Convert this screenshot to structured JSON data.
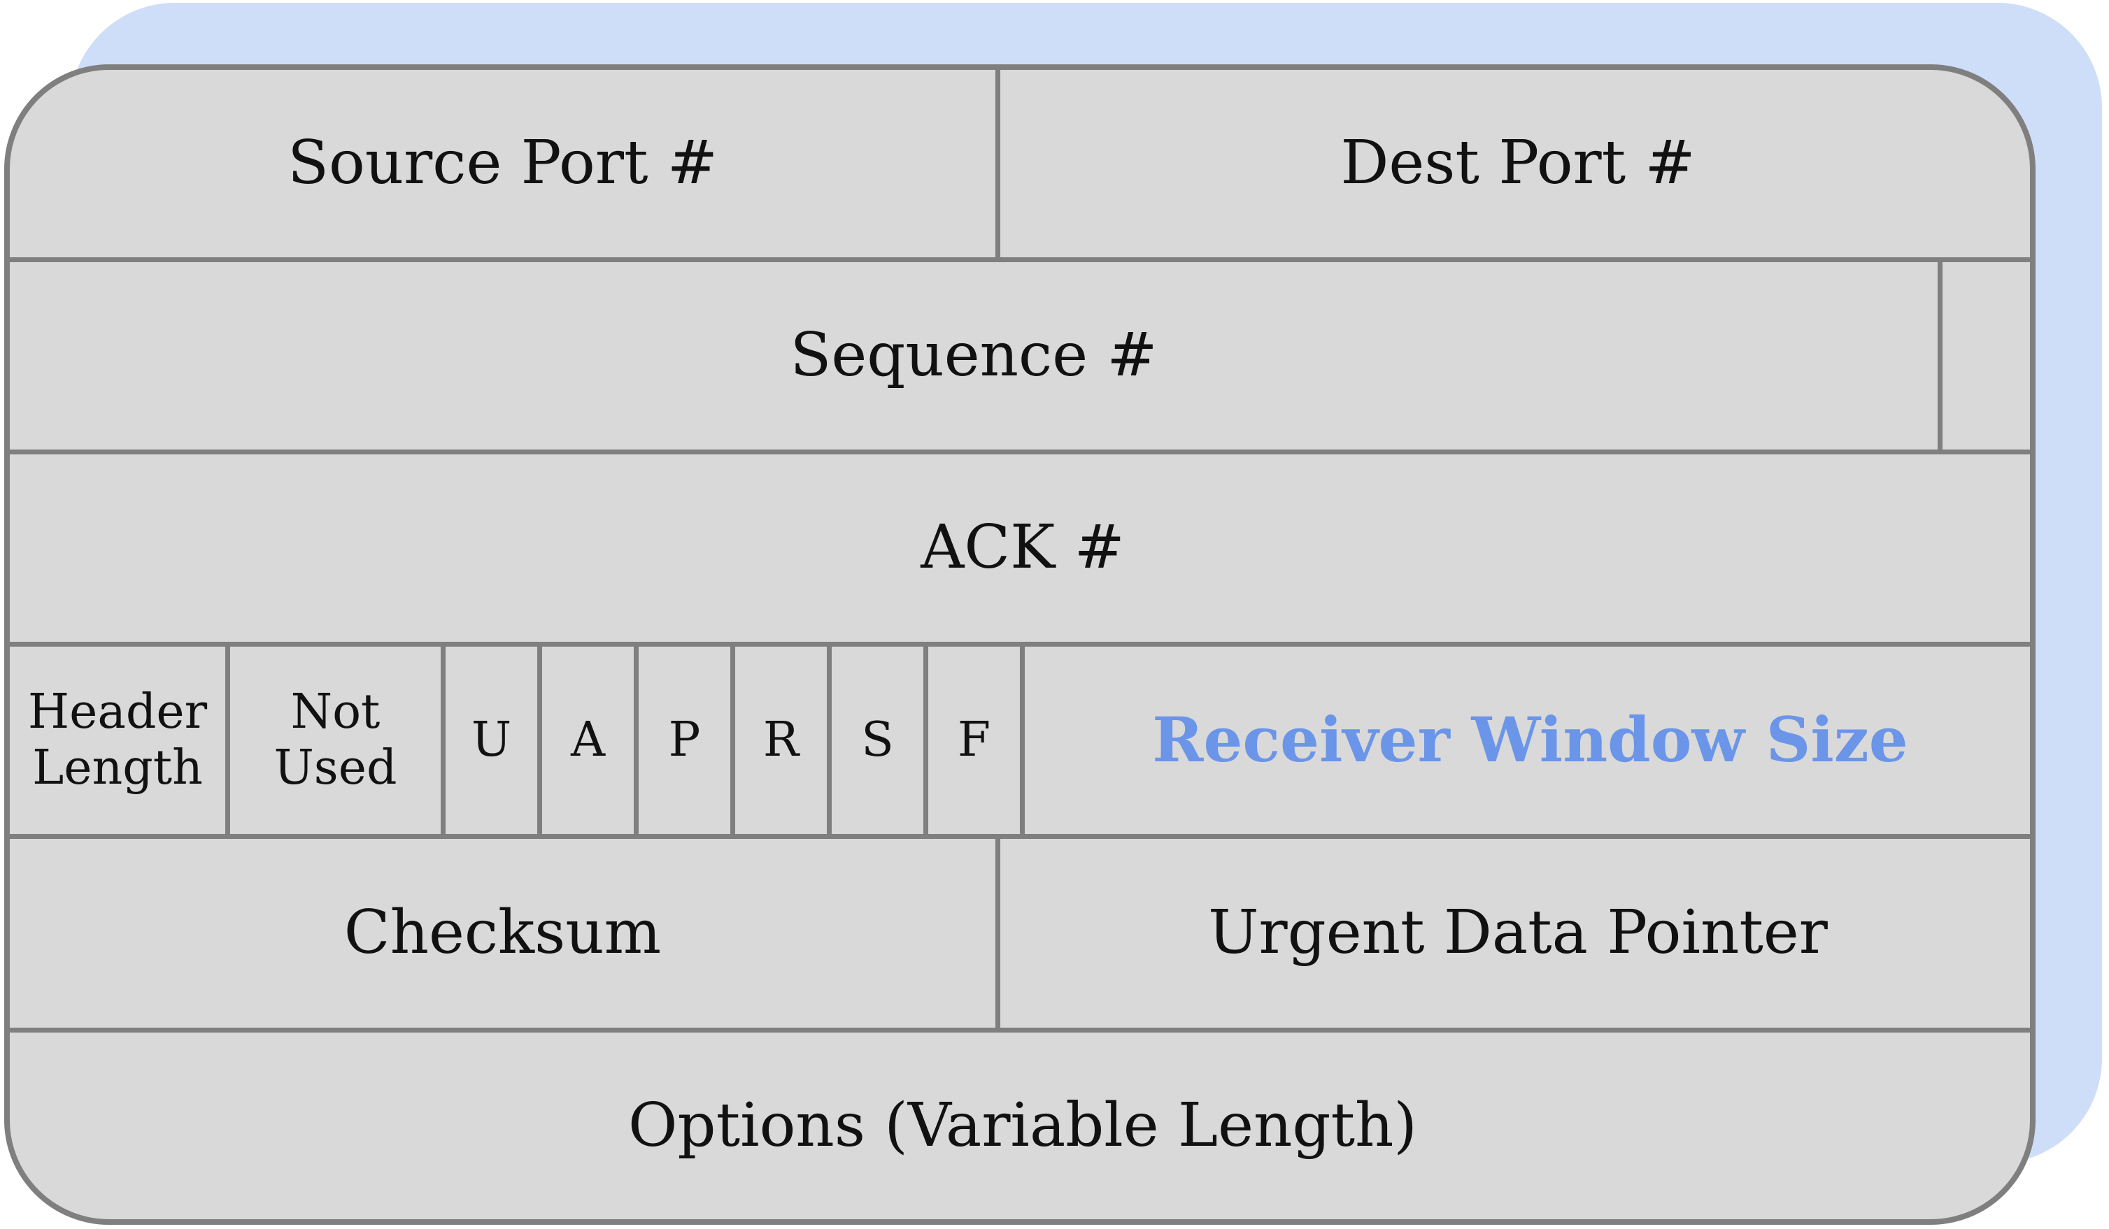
{
  "colors": {
    "shadow": "#cfdef8",
    "fill": "#d9d9d9",
    "border": "#7f7f7f",
    "text": "#111111",
    "accent": "#6a95e8"
  },
  "fields": {
    "source_port": "Source Port #",
    "dest_port": "Dest Port #",
    "sequence": "Sequence #",
    "ack": "ACK #",
    "header_length": "Header\nLength",
    "not_used": "Not\nUsed",
    "flags": [
      "U",
      "A",
      "P",
      "R",
      "S",
      "F"
    ],
    "receiver_window": "Receiver Window Size",
    "checksum": "Checksum",
    "urgent_pointer": "Urgent Data Pointer",
    "options": "Options (Variable Length)"
  }
}
